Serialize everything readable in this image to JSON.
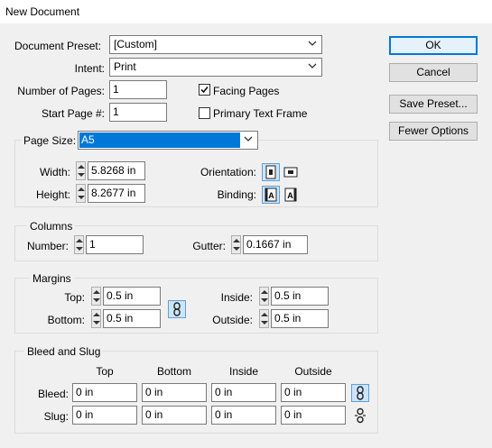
{
  "window": {
    "title": "New Document"
  },
  "document_preset": {
    "label": "Document Preset:",
    "value": "[Custom]"
  },
  "intent": {
    "label": "Intent:",
    "value": "Print"
  },
  "pages": {
    "number_label": "Number of Pages:",
    "number_value": "1",
    "start_label": "Start Page #:",
    "start_value": "1",
    "facing_label": "Facing Pages",
    "facing_checked": true,
    "primary_frame_label": "Primary Text Frame",
    "primary_frame_checked": false
  },
  "page_size": {
    "label": "Page Size:",
    "value": "A5",
    "width_label": "Width:",
    "width_value": "5.8268 in",
    "height_label": "Height:",
    "height_value": "8.2677 in",
    "orientation_label": "Orientation:",
    "binding_label": "Binding:"
  },
  "columns": {
    "title": "Columns",
    "number_label": "Number:",
    "number_value": "1",
    "gutter_label": "Gutter:",
    "gutter_value": "0.1667 in"
  },
  "margins": {
    "title": "Margins",
    "top_label": "Top:",
    "top_value": "0.5 in",
    "bottom_label": "Bottom:",
    "bottom_value": "0.5 in",
    "inside_label": "Inside:",
    "inside_value": "0.5 in",
    "outside_label": "Outside:",
    "outside_value": "0.5 in"
  },
  "bleed_slug": {
    "title": "Bleed and Slug",
    "columns": [
      "Top",
      "Bottom",
      "Inside",
      "Outside"
    ],
    "bleed_label": "Bleed:",
    "bleed_values": [
      "0 in",
      "0 in",
      "0 in",
      "0 in"
    ],
    "slug_label": "Slug:",
    "slug_values": [
      "0 in",
      "0 in",
      "0 in",
      "0 in"
    ]
  },
  "buttons": {
    "ok": "OK",
    "cancel": "Cancel",
    "save_preset": "Save Preset...",
    "fewer_options": "Fewer Options"
  },
  "colors": {
    "accent": "#0078d7",
    "selected_icon_bg": "#cce4f7"
  }
}
